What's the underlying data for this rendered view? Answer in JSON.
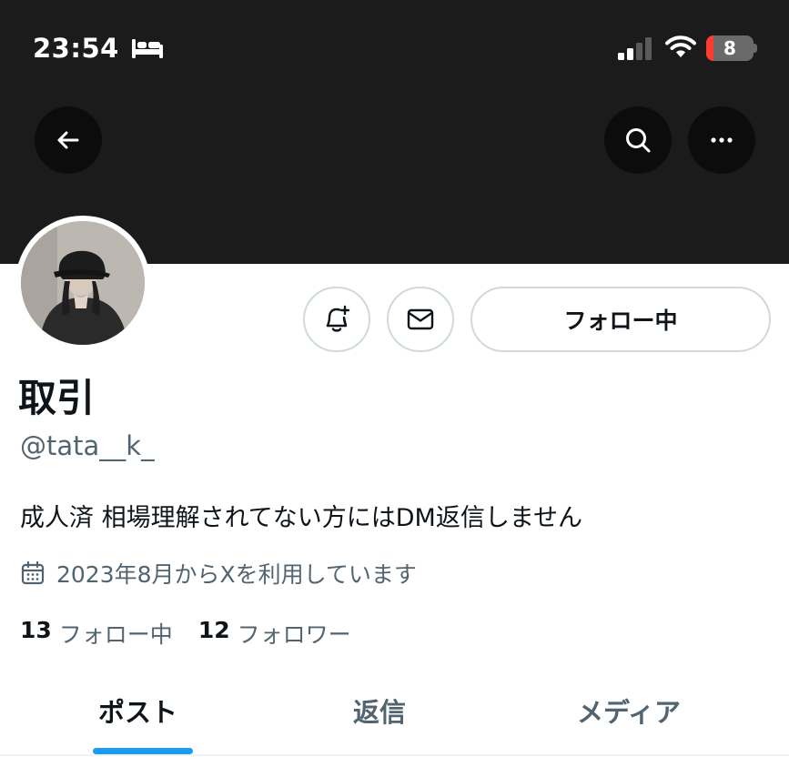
{
  "status_bar": {
    "time": "23:54",
    "battery_level": "8",
    "icons": [
      "bed-icon",
      "signal-icon",
      "wifi-icon",
      "battery-icon"
    ],
    "battery_color": "#ff3b30"
  },
  "header": {
    "back_icon": "arrow-left-icon",
    "search_icon": "search-icon",
    "more_icon": "ellipsis-icon",
    "banner_color": "#1b1b1b"
  },
  "profile": {
    "display_name": "取引",
    "handle": "@tata__k_",
    "bio": "成人済 相場理解されてない方にはDM返信しません",
    "joined": "2023年8月からXを利用しています",
    "following_count": "13",
    "following_label": "フォロー中",
    "followers_count": "12",
    "followers_label": "フォロワー"
  },
  "actions": {
    "notify_icon": "bell-plus-icon",
    "message_icon": "envelope-icon",
    "follow_label": "フォロー中"
  },
  "tabs": [
    {
      "label": "ポスト",
      "active": true
    },
    {
      "label": "返信",
      "active": false
    },
    {
      "label": "メディア",
      "active": false
    }
  ],
  "colors": {
    "accent": "#1d9bf0",
    "text_primary": "#0f1419",
    "text_secondary": "#536471",
    "border": "#cfd9de"
  }
}
